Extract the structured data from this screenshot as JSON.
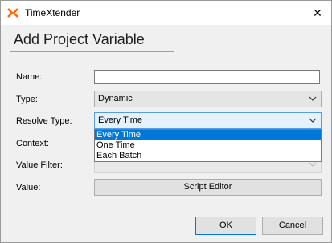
{
  "window": {
    "title": "TimeXtender",
    "close_glyph": "✕",
    "logo_icon": "timextender-logo-icon",
    "accent_color": "#ff6600"
  },
  "dialog": {
    "heading": "Add Project Variable"
  },
  "form": {
    "name": {
      "label": "Name:",
      "value": ""
    },
    "type": {
      "label": "Type:",
      "value": "Dynamic"
    },
    "resolve_type": {
      "label": "Resolve Type:",
      "value": "Every Time",
      "expanded": true,
      "options": [
        "Every Time",
        "One Time",
        "Each Batch"
      ],
      "selected_index": 0
    },
    "context": {
      "label": "Context:",
      "value": ""
    },
    "value_filter": {
      "label": "Value Filter:",
      "value": "",
      "disabled": true
    },
    "value": {
      "label": "Value:",
      "button_label": "Script Editor"
    }
  },
  "footer": {
    "ok_label": "OK",
    "cancel_label": "Cancel"
  },
  "colors": {
    "selection": "#0078d7",
    "focus_border": "#569de5"
  }
}
